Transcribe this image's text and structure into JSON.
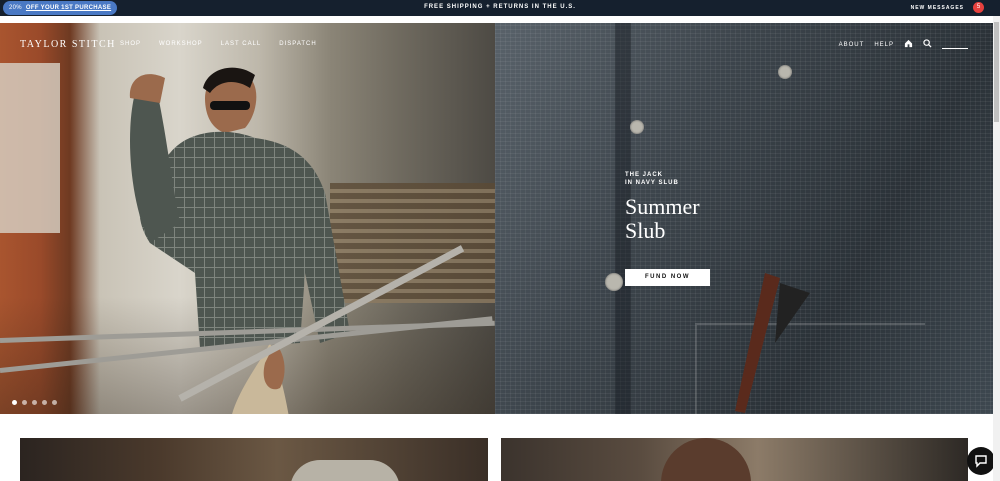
{
  "announcement": {
    "promo_percent": "20%",
    "promo_text": "OFF YOUR 1ST PURCHASE",
    "shipping_text": "FREE SHIPPING + RETURNS IN THE U.S.",
    "messages_label": "NEW MESSAGES",
    "messages_count": "5"
  },
  "header": {
    "logo": "TAYLOR STITCH",
    "nav": [
      "SHOP",
      "WORKSHOP",
      "LAST CALL",
      "DISPATCH"
    ],
    "right_links": [
      "ABOUT",
      "HELP"
    ],
    "icons": [
      "home-icon",
      "search-icon"
    ]
  },
  "hero": {
    "eyebrow_line1": "THE JACK",
    "eyebrow_line2": "IN NAVY SLUB",
    "headline_line1": "Summer",
    "headline_line2": "Slub",
    "cta_label": "FUND NOW",
    "slide_count": 5,
    "active_slide": 1
  },
  "colors": {
    "announce_bg": "#15202e",
    "promo_bg": "#4a79c4",
    "badge": "#e6413e"
  }
}
